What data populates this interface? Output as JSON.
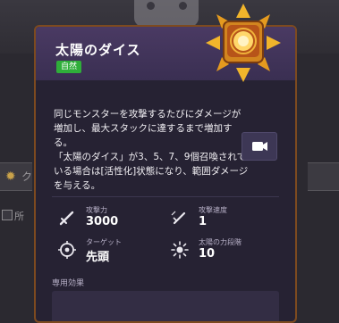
{
  "card": {
    "title": "太陽のダイス",
    "badge": "自然",
    "description": [
      "同じモンスターを攻撃するたびにダメージが増加し、最大スタックに達するまで増加する。",
      "「太陽のダイス」が3、5、7、9個召喚されている場合は[活性化]状態になり、範囲ダメージを与える。"
    ],
    "stats": [
      {
        "label": "攻撃力",
        "value": "3000",
        "icon": "sword-icon"
      },
      {
        "label": "攻撃速度",
        "value": "1",
        "icon": "dagger-speed-icon"
      },
      {
        "label": "ターゲット",
        "value": "先頭",
        "icon": "target-icon"
      },
      {
        "label": "太陽の力段階",
        "value": "10",
        "icon": "sun-burst-icon"
      }
    ],
    "exclusive_label": "専用効果",
    "video_icon": "video-camera-icon",
    "accent_color": "#2fae3a"
  },
  "background": {
    "left_tab_glyph": "ク",
    "left_checkbox_text": "所"
  }
}
